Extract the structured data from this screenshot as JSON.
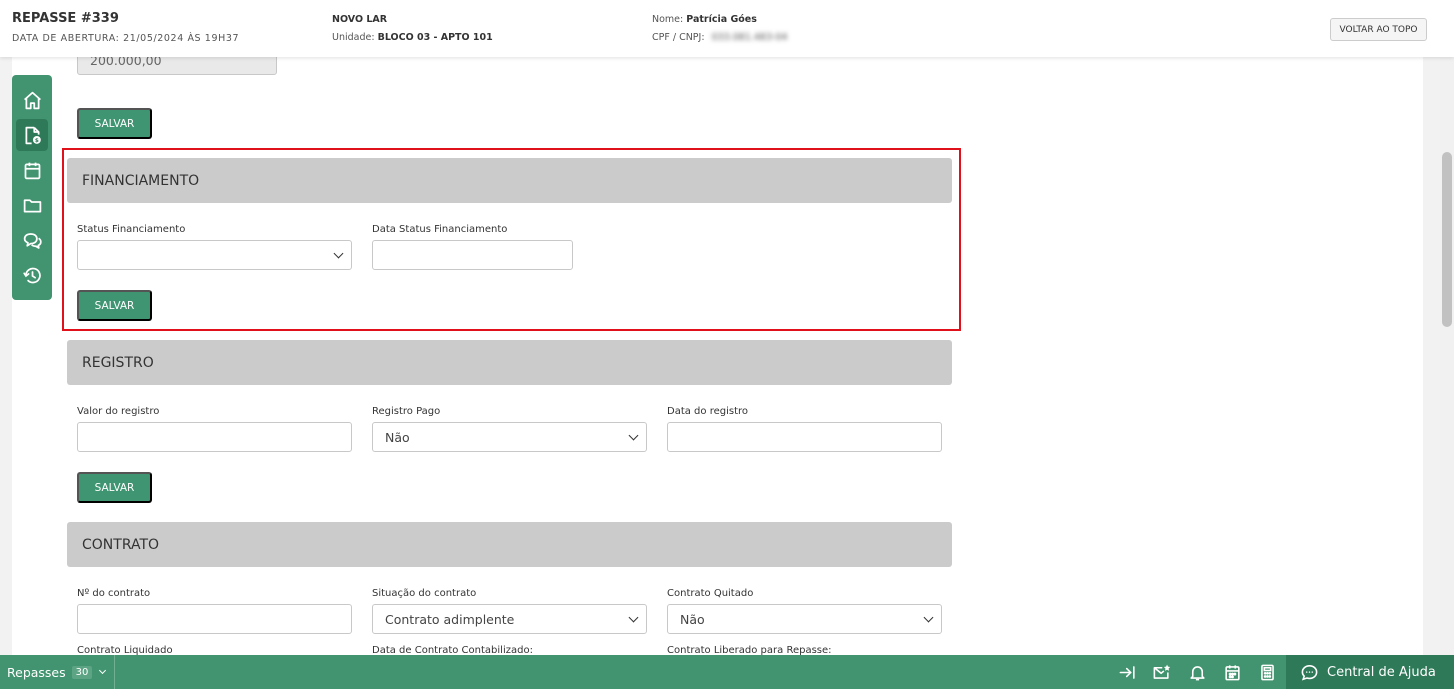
{
  "header": {
    "title": "REPASSE #339",
    "opening_date": "DATA DE ABERTURA: 21/05/2024 ÀS 19H37",
    "project": "NOVO LAR",
    "unit_label": "Unidade:",
    "unit_value": "BLOCO 03 - APTO 101",
    "name_label": "Nome:",
    "name_value": "Patrícia Góes",
    "cpf_label": "CPF / CNPJ:",
    "cpf_value": "033.081.483-04",
    "back_to_top": "VOLTAR AO TOPO"
  },
  "top_partial": {
    "value": "200.000,00",
    "save_label": "SALVAR"
  },
  "financiamento": {
    "title": "FINANCIAMENTO",
    "status_label": "Status Financiamento",
    "status_value": "",
    "date_label": "Data Status Financiamento",
    "date_value": "",
    "save_label": "SALVAR"
  },
  "registro": {
    "title": "REGISTRO",
    "valor_label": "Valor do registro",
    "valor_value": "",
    "pago_label": "Registro Pago",
    "pago_value": "Não",
    "data_label": "Data do registro",
    "data_value": "",
    "save_label": "SALVAR"
  },
  "contrato": {
    "title": "CONTRATO",
    "numero_label": "Nº do contrato",
    "numero_value": "",
    "situacao_label": "Situação do contrato",
    "situacao_value": "Contrato adimplente",
    "quitado_label": "Contrato Quitado",
    "quitado_value": "Não",
    "liquidado_label": "Contrato Liquidado",
    "contabilizado_label": "Data de Contrato Contabilizado:",
    "liberado_label": "Contrato Liberado para Repasse:"
  },
  "sidebar": {
    "icons": [
      "home-icon",
      "document-badge-icon",
      "calendar-icon",
      "folder-icon",
      "chat-icon",
      "history-icon"
    ]
  },
  "footer": {
    "module_label": "Repasses",
    "count": "30",
    "help_label": "Central de Ajuda"
  },
  "colors": {
    "brand_green": "#41946f",
    "section_gray": "#cbcbcb",
    "highlight_red": "#e0111b"
  }
}
